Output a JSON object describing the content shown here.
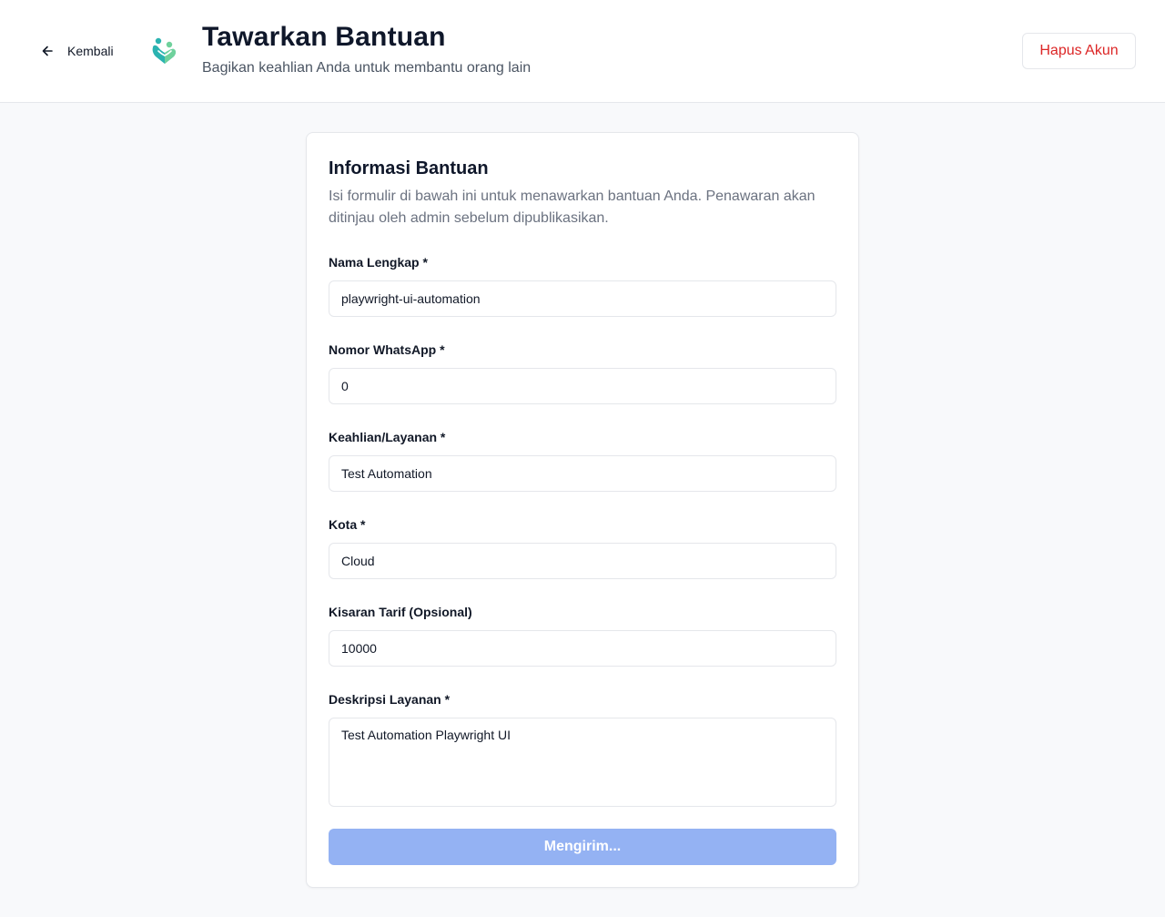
{
  "header": {
    "back_label": "Kembali",
    "title": "Tawarkan Bantuan",
    "subtitle": "Bagikan keahlian Anda untuk membantu orang lain",
    "delete_account_label": "Hapus Akun"
  },
  "colors": {
    "accent": "#94b2f3",
    "danger": "#dc2626",
    "logo_teal": "#2bb3b1",
    "logo_green": "#6fd19c"
  },
  "icons": {
    "back": "arrow-left-icon",
    "logo": "heart-people-logo-icon"
  },
  "form": {
    "title": "Informasi Bantuan",
    "description": "Isi formulir di bawah ini untuk menawarkan bantuan Anda. Penawaran akan ditinjau oleh admin sebelum dipublikasikan.",
    "fields": [
      {
        "label": "Nama Lengkap *",
        "value": "playwright-ui-automation"
      },
      {
        "label": "Nomor WhatsApp *",
        "value": "0"
      },
      {
        "label": "Keahlian/Layanan *",
        "value": "Test Automation"
      },
      {
        "label": "Kota *",
        "value": "Cloud"
      },
      {
        "label": "Kisaran Tarif (Opsional)",
        "value": "10000"
      },
      {
        "label": "Deskripsi Layanan *",
        "value": "Test Automation Playwright UI"
      }
    ],
    "submit_label": "Mengirim..."
  }
}
